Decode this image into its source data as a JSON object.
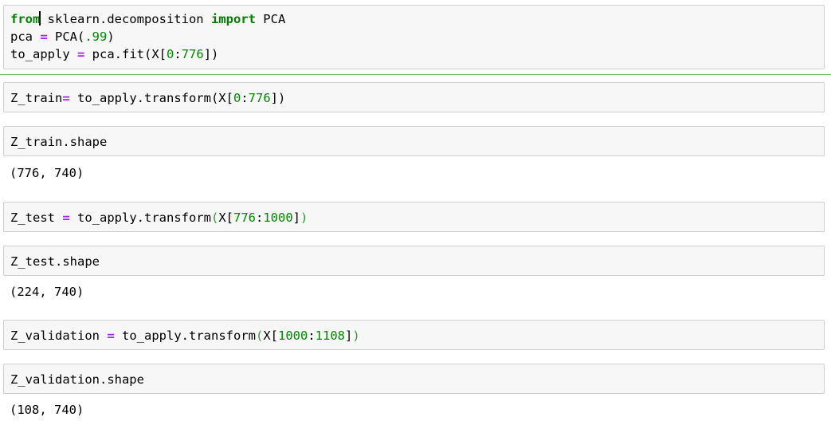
{
  "cells": [
    {
      "tokens": [
        [
          {
            "t": "from",
            "c": "kw"
          },
          {
            "t": "",
            "c": "cursor"
          },
          {
            "t": " sklearn.decomposition ",
            "c": ""
          },
          {
            "t": "import",
            "c": "kw"
          },
          {
            "t": " PCA",
            "c": ""
          }
        ],
        [
          {
            "t": "pca ",
            "c": ""
          },
          {
            "t": "=",
            "c": "op"
          },
          {
            "t": " PCA(",
            "c": ""
          },
          {
            "t": ".99",
            "c": "num"
          },
          {
            "t": ")",
            "c": ""
          }
        ],
        [
          {
            "t": "to_apply ",
            "c": ""
          },
          {
            "t": "=",
            "c": "op"
          },
          {
            "t": " pca.fit(X[",
            "c": ""
          },
          {
            "t": "0",
            "c": "num"
          },
          {
            "t": ":",
            "c": ""
          },
          {
            "t": "776",
            "c": "num"
          },
          {
            "t": "])",
            "c": ""
          }
        ]
      ]
    },
    {
      "tokens": [
        [
          {
            "t": "Z_train",
            "c": ""
          },
          {
            "t": "=",
            "c": "op"
          },
          {
            "t": " to_apply.transform(X[",
            "c": ""
          },
          {
            "t": "0",
            "c": "num"
          },
          {
            "t": ":",
            "c": ""
          },
          {
            "t": "776",
            "c": "num"
          },
          {
            "t": "])",
            "c": ""
          }
        ]
      ]
    },
    {
      "tokens": [
        [
          {
            "t": "Z_train.shape",
            "c": ""
          }
        ]
      ],
      "output": "(776, 740)"
    },
    {
      "tokens": [
        [
          {
            "t": "Z_test ",
            "c": ""
          },
          {
            "t": "=",
            "c": "op"
          },
          {
            "t": " to_apply.transform",
            "c": ""
          },
          {
            "t": "(",
            "c": "pm"
          },
          {
            "t": "X[",
            "c": ""
          },
          {
            "t": "776",
            "c": "num"
          },
          {
            "t": ":",
            "c": ""
          },
          {
            "t": "1000",
            "c": "num"
          },
          {
            "t": "]",
            "c": ""
          },
          {
            "t": ")",
            "c": "pm"
          }
        ]
      ]
    },
    {
      "tokens": [
        [
          {
            "t": "Z_test.shape",
            "c": ""
          }
        ]
      ],
      "output": "(224, 740)"
    },
    {
      "tokens": [
        [
          {
            "t": "Z_validation ",
            "c": ""
          },
          {
            "t": "=",
            "c": "op"
          },
          {
            "t": " to_apply.transform",
            "c": ""
          },
          {
            "t": "(",
            "c": "pm"
          },
          {
            "t": "X[",
            "c": ""
          },
          {
            "t": "1000",
            "c": "num"
          },
          {
            "t": ":",
            "c": ""
          },
          {
            "t": "1108",
            "c": "num"
          },
          {
            "t": "]",
            "c": ""
          },
          {
            "t": ")",
            "c": "pm"
          }
        ]
      ]
    },
    {
      "tokens": [
        [
          {
            "t": "Z_validation.shape",
            "c": ""
          }
        ]
      ],
      "output": "(108, 740)"
    }
  ]
}
